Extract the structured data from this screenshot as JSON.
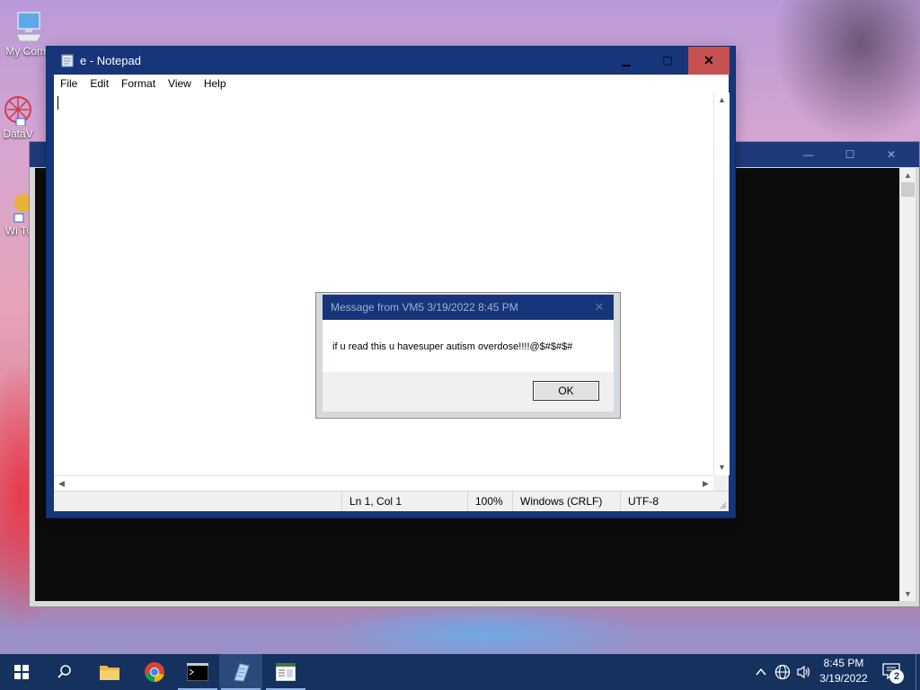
{
  "desktop": {
    "icons": [
      {
        "label": "My Comp"
      },
      {
        "label": "DataV"
      },
      {
        "label": "Wi Tw"
      }
    ]
  },
  "notepad": {
    "title": "e - Notepad",
    "menu": [
      "File",
      "Edit",
      "Format",
      "View",
      "Help"
    ],
    "content": "",
    "status": {
      "position": "Ln 1, Col 1",
      "zoom": "100%",
      "line_ending": "Windows (CRLF)",
      "encoding": "UTF-8"
    }
  },
  "dialog": {
    "title": "Message from VM5 3/19/2022 8:45 PM",
    "message": "if u read this u havesuper autism overdose!!!!@$#$#$#",
    "ok_label": "OK"
  },
  "taskbar": {
    "clock_time": "8:45 PM",
    "clock_date": "3/19/2022",
    "notification_count": "2"
  },
  "colors": {
    "window_frame": "#16357a",
    "close_button": "#c75050",
    "taskbar": "#15315e"
  }
}
